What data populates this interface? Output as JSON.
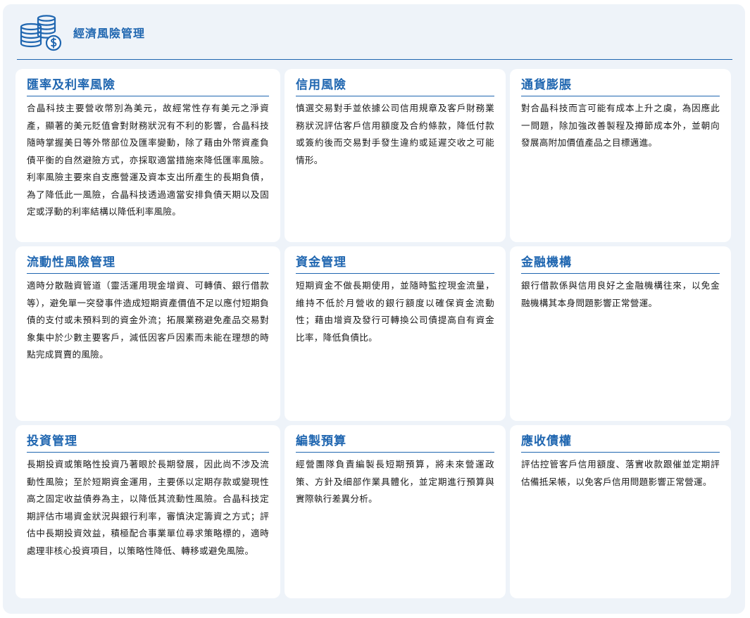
{
  "header": {
    "title": "經濟風險管理",
    "icon": "coins-dollar-icon"
  },
  "colors": {
    "accent": "#1f66b0",
    "panel": "#eef3f9",
    "card": "#ffffff"
  },
  "cards": [
    {
      "title": "匯率及利率風險",
      "body": "合晶科技主要營收幣別為美元，故經常性存有美元之淨資產，顯著的美元貶值會對財務狀況有不利的影響，合晶科技隨時掌握美日等外幣部位及匯率變動，除了藉由外幣資產負債平衡的自然避險方式，亦採取適當措施來降低匯率風險。利率風險主要來自支應營運及資本支出所產生的長期負債，為了降低此一風險，合晶科技透過適當安排負債天期以及固定或浮動的利率結構以降低利率風險。"
    },
    {
      "title": "信用風險",
      "body": "慎選交易對手並依據公司信用規章及客戶財務業務狀況評估客戶信用額度及合約條款，降低付款或簽約後而交易對手發生違約或延遲交收之可能情形。"
    },
    {
      "title": "通貨膨脹",
      "body": "對合晶科技而言可能有成本上升之虞，為因應此一問題，除加強改善製程及撙節成本外，並朝向發展高附加價值產品之目標邁進。"
    },
    {
      "title": "流動性風險管理",
      "body": "適時分散融資管道（靈活運用現金增資、可轉債、銀行借款等），避免單一突發事件造成短期資產價值不足以應付短期負債的支付或未預料到的資金外流；拓展業務避免產品交易對象集中於少數主要客戶，減低因客戶因素而未能在理想的時點完成買賣的風險。"
    },
    {
      "title": "資金管理",
      "body": "短期資金不做長期使用，並隨時監控現金流量，維持不低於月營收的銀行額度以確保資金流動性；藉由增資及發行可轉換公司債提高自有資金比率，降低負債比。"
    },
    {
      "title": "金融機構",
      "body": "銀行借款係與信用良好之金融機構往來，以免金融機構其本身問題影響正常營運。"
    },
    {
      "title": "投資管理",
      "body": "長期投資或策略性投資乃著眼於長期發展，因此尚不涉及流動性風險；至於短期資金運用，主要係以定期存款或變現性高之固定收益債券為主，以降低其流動性風險。合晶科技定期評估市場資金狀況與銀行利率，審慎決定籌資之方式；評估中長期投資效益，積極配合事業單位尋求策略標的，適時處理非核心投資項目，以策略性降低、轉移或避免風險。"
    },
    {
      "title": "編製預算",
      "body": "經營團隊負責編製長短期預算，將未來營運政策、方針及細部作業具體化，並定期進行預算與實際執行差異分析。"
    },
    {
      "title": "應收債權",
      "body": "評估控管客戶信用額度、落實收款跟催並定期評估備抵呆帳，以免客戶信用問題影響正常營運。"
    }
  ]
}
